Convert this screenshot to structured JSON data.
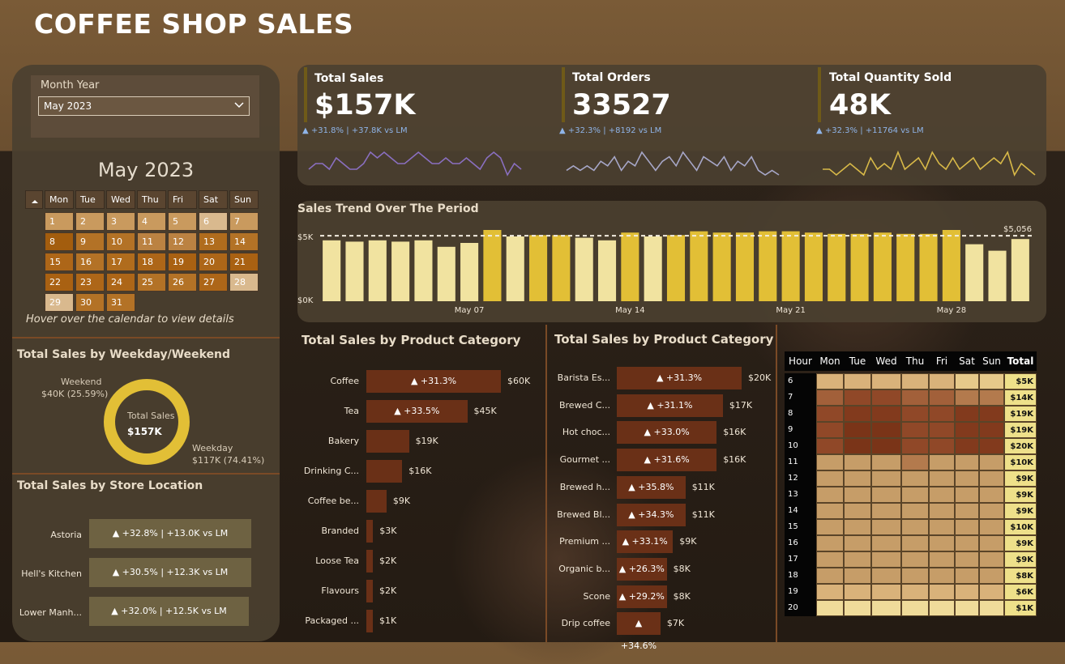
{
  "title": "COFFEE SHOP SALES",
  "slicer": {
    "label": "Month Year",
    "selected": "May 2023"
  },
  "calendar": {
    "title": "May 2023",
    "weekdays": [
      "Mon",
      "Tue",
      "Wed",
      "Thu",
      "Fri",
      "Sat",
      "Sun"
    ],
    "hint": "Hover over the calendar to view details",
    "days": [
      {
        "d": "1",
        "c": "#c99a5e"
      },
      {
        "d": "2",
        "c": "#c99a5e"
      },
      {
        "d": "3",
        "c": "#c99a5e"
      },
      {
        "d": "4",
        "c": "#c99a5e"
      },
      {
        "d": "5",
        "c": "#c99a5e"
      },
      {
        "d": "6",
        "c": "#d9b98e"
      },
      {
        "d": "7",
        "c": "#c99a5e"
      },
      {
        "d": "8",
        "c": "#a35d0e"
      },
      {
        "d": "9",
        "c": "#b37226"
      },
      {
        "d": "10",
        "c": "#b37226"
      },
      {
        "d": "11",
        "c": "#bb8242"
      },
      {
        "d": "12",
        "c": "#bb8242"
      },
      {
        "d": "13",
        "c": "#b06c1d"
      },
      {
        "d": "14",
        "c": "#b37226"
      },
      {
        "d": "15",
        "c": "#ad6618"
      },
      {
        "d": "16",
        "c": "#b37226"
      },
      {
        "d": "17",
        "c": "#b06c1d"
      },
      {
        "d": "18",
        "c": "#ad6618"
      },
      {
        "d": "19",
        "c": "#a96112"
      },
      {
        "d": "20",
        "c": "#ad6618"
      },
      {
        "d": "21",
        "c": "#a96112"
      },
      {
        "d": "22",
        "c": "#a96112"
      },
      {
        "d": "23",
        "c": "#ad6618"
      },
      {
        "d": "24",
        "c": "#ad6618"
      },
      {
        "d": "25",
        "c": "#b37226"
      },
      {
        "d": "26",
        "c": "#b37226"
      },
      {
        "d": "27",
        "c": "#ad6618"
      },
      {
        "d": "28",
        "c": "#d9b98e"
      },
      {
        "d": "29",
        "c": "#d9b98e"
      },
      {
        "d": "30",
        "c": "#b37226"
      },
      {
        "d": "31",
        "c": "#b37226"
      }
    ]
  },
  "weekday_weekend": {
    "title": "Total Sales by Weekday/Weekend",
    "weekend_label": "Weekend",
    "weekend_value": "$40K (25.59%)",
    "weekday_label": "Weekday",
    "weekday_value": "$117K (74.41%)",
    "center_label": "Total Sales",
    "center_value": "$157K",
    "weekend_share": 25.59,
    "weekday_share": 74.41,
    "colors": {
      "weekday": "#e2bf36",
      "weekend": "#6f5a18"
    }
  },
  "store_location": {
    "title": "Total Sales by Store Location",
    "rows": [
      {
        "name": "Astoria",
        "text": "▲ +32.8% | +13.0K vs LM"
      },
      {
        "name": "Hell's Kitchen",
        "text": "▲ +30.5% | +12.3K vs LM"
      },
      {
        "name": "Lower Manh...",
        "text": "▲ +32.0% | +12.5K vs LM"
      }
    ]
  },
  "kpis": [
    {
      "label": "Total Sales",
      "value": "$157K",
      "delta": "▲ +31.8% | +37.8K vs LM",
      "spark_color": "#8a6fc0",
      "spark": [
        5,
        6,
        6,
        5,
        7,
        6,
        5,
        5,
        6,
        8,
        7,
        8,
        7,
        6,
        6,
        7,
        8,
        7,
        6,
        6,
        7,
        6,
        6,
        7,
        6,
        5,
        7,
        8,
        7,
        4,
        6,
        5
      ]
    },
    {
      "label": "Total Orders",
      "value": "33527",
      "delta": "▲ +32.3% | +8192 vs LM",
      "spark_color": "#a7a7c8",
      "spark": [
        4,
        5,
        4,
        5,
        4,
        6,
        5,
        7,
        4,
        6,
        5,
        8,
        6,
        4,
        6,
        7,
        5,
        8,
        6,
        4,
        7,
        6,
        5,
        7,
        4,
        6,
        5,
        7,
        4,
        3,
        4,
        3
      ]
    },
    {
      "label": "Total Quantity Sold",
      "value": "48K",
      "delta": "▲ +32.3% | +11764 vs LM",
      "spark_color": "#d8b948",
      "spark": [
        5,
        5,
        4,
        5,
        6,
        5,
        4,
        7,
        5,
        6,
        5,
        8,
        5,
        6,
        7,
        5,
        8,
        6,
        5,
        7,
        5,
        6,
        7,
        5,
        6,
        7,
        6,
        8,
        4,
        6,
        5,
        4
      ]
    }
  ],
  "trend": {
    "title": "Sales Trend Over The Period",
    "avg_label": "$5,056",
    "xlabels": [
      "May 07",
      "May 14",
      "May 21",
      "May 28"
    ]
  },
  "chart_data": [
    {
      "type": "bar",
      "title": "Sales Trend Over The Period",
      "categories": [
        "1",
        "2",
        "3",
        "4",
        "5",
        "6",
        "7",
        "8",
        "9",
        "10",
        "11",
        "12",
        "13",
        "14",
        "15",
        "16",
        "17",
        "18",
        "19",
        "20",
        "21",
        "22",
        "23",
        "24",
        "25",
        "26",
        "27",
        "28",
        "29",
        "30",
        "31"
      ],
      "values": [
        4700,
        4600,
        4700,
        4600,
        4700,
        4200,
        4500,
        5500,
        5000,
        5100,
        5100,
        4900,
        4700,
        5300,
        5000,
        5100,
        5400,
        5300,
        5300,
        5400,
        5400,
        5300,
        5200,
        5200,
        5300,
        5200,
        5200,
        5500,
        4400,
        3900,
        4800
      ],
      "ylim": [
        0,
        5500
      ],
      "ytick_labels": [
        "$0K",
        "$5K"
      ],
      "average": 5056,
      "colors": {
        "above": "#e2bf36",
        "below": "#f1e3a0"
      }
    },
    {
      "type": "bar",
      "title": "Total Sales by Product Category",
      "categories": [
        "Coffee",
        "Tea",
        "Bakery",
        "Drinking C...",
        "Coffee be...",
        "Branded",
        "Loose Tea",
        "Flavours",
        "Packaged ..."
      ],
      "values": [
        60,
        45,
        19,
        16,
        9,
        3,
        2,
        2,
        1
      ],
      "value_labels": [
        "$60K",
        "$45K",
        "$19K",
        "$16K",
        "$9K",
        "$3K",
        "$2K",
        "$2K",
        "$1K"
      ],
      "deltas": [
        "▲ +31.3%",
        "▲ +33.5%",
        "",
        "",
        "",
        "",
        "",
        "",
        ""
      ]
    },
    {
      "type": "bar",
      "title": "Total Sales by Product Category",
      "categories": [
        "Barista Es...",
        "Brewed C...",
        "Hot choc...",
        "Gourmet ...",
        "Brewed h...",
        "Brewed Bl...",
        "Premium ...",
        "Organic b...",
        "Scone",
        "Drip coffee"
      ],
      "values": [
        20,
        17,
        16,
        16,
        11,
        11,
        9,
        8,
        8,
        7
      ],
      "value_labels": [
        "$20K",
        "$17K",
        "$16K",
        "$16K",
        "$11K",
        "$11K",
        "$9K",
        "$8K",
        "$8K",
        "$7K"
      ],
      "deltas": [
        "▲ +31.3%",
        "▲ +31.1%",
        "▲ +33.0%",
        "▲ +31.6%",
        "▲ +35.8%",
        "▲ +34.3%",
        "▲ +33.1%",
        "▲ +26.3%",
        "▲ +29.2%",
        "▲ +34.6%"
      ]
    },
    {
      "type": "heatmap",
      "columns": [
        "Hour",
        "Mon",
        "Tue",
        "Wed",
        "Thu",
        "Fri",
        "Sat",
        "Sun",
        "Total"
      ],
      "rows": [
        {
          "hour": "6",
          "total": "$5K",
          "cells": [
            3,
            3,
            3,
            3,
            3,
            2,
            2
          ]
        },
        {
          "hour": "7",
          "total": "$14K",
          "cells": [
            6,
            7,
            7,
            6,
            6,
            5,
            5
          ]
        },
        {
          "hour": "8",
          "total": "$19K",
          "cells": [
            7,
            8,
            8,
            7,
            7,
            8,
            8
          ]
        },
        {
          "hour": "9",
          "total": "$19K",
          "cells": [
            7,
            9,
            9,
            7,
            7,
            8,
            8
          ]
        },
        {
          "hour": "10",
          "total": "$20K",
          "cells": [
            7,
            9,
            9,
            7,
            7,
            8,
            8
          ]
        },
        {
          "hour": "11",
          "total": "$10K",
          "cells": [
            4,
            4,
            4,
            5,
            4,
            4,
            4
          ]
        },
        {
          "hour": "12",
          "total": "$9K",
          "cells": [
            4,
            4,
            4,
            4,
            4,
            4,
            4
          ]
        },
        {
          "hour": "13",
          "total": "$9K",
          "cells": [
            4,
            4,
            4,
            4,
            4,
            4,
            4
          ]
        },
        {
          "hour": "14",
          "total": "$9K",
          "cells": [
            4,
            4,
            4,
            4,
            4,
            4,
            4
          ]
        },
        {
          "hour": "15",
          "total": "$10K",
          "cells": [
            4,
            4,
            4,
            4,
            4,
            4,
            4
          ]
        },
        {
          "hour": "16",
          "total": "$9K",
          "cells": [
            4,
            4,
            4,
            4,
            4,
            4,
            4
          ]
        },
        {
          "hour": "17",
          "total": "$9K",
          "cells": [
            4,
            4,
            4,
            4,
            4,
            4,
            4
          ]
        },
        {
          "hour": "18",
          "total": "$8K",
          "cells": [
            4,
            4,
            4,
            4,
            4,
            4,
            4
          ]
        },
        {
          "hour": "19",
          "total": "$6K",
          "cells": [
            3,
            3,
            3,
            3,
            3,
            3,
            3
          ]
        },
        {
          "hour": "20",
          "total": "$1K",
          "cells": [
            1,
            1,
            1,
            1,
            1,
            1,
            1
          ]
        }
      ]
    }
  ]
}
